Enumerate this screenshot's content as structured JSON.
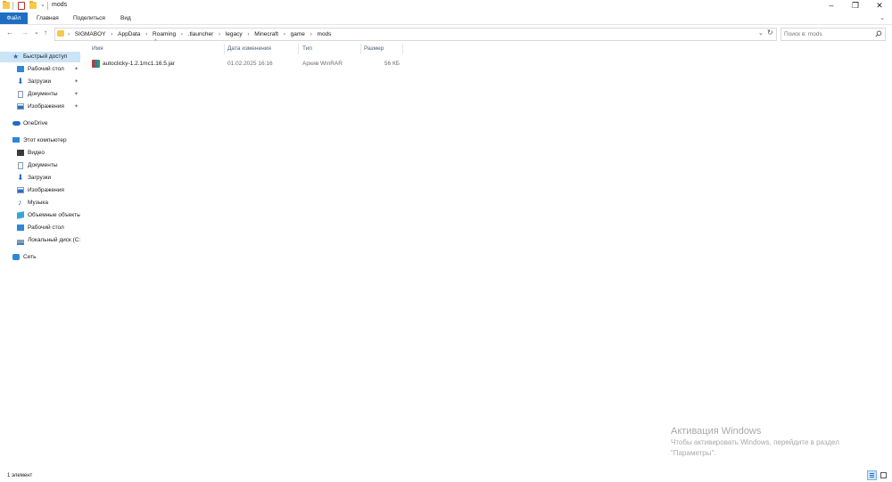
{
  "window": {
    "title": "mods",
    "controls": {
      "minimize": "–",
      "maximize": "❐",
      "close": "✕"
    }
  },
  "ribbon": {
    "tabs": [
      "Файл",
      "Главная",
      "Поделиться",
      "Вид"
    ],
    "chevron": "⌄"
  },
  "nav": {
    "back": "←",
    "forward": "→",
    "recent": "⌄",
    "up": "↑",
    "refresh": "↻",
    "addr_dropdown": "⌄"
  },
  "address": {
    "crumbs": [
      "SIGMABOY",
      "AppData",
      "Roaming",
      ".tlauncher",
      "legacy",
      "Minecraft",
      "game",
      "mods"
    ],
    "separator": "›"
  },
  "search": {
    "placeholder": "Поиск в: mods",
    "icon": "search-icon"
  },
  "sidebar": {
    "quick_access": {
      "label": "Быстрый доступ",
      "items": [
        {
          "label": "Рабочий стол",
          "icon": "desktop-icon",
          "pinned": true
        },
        {
          "label": "Загрузки",
          "icon": "download-icon",
          "pinned": true
        },
        {
          "label": "Документы",
          "icon": "document-icon",
          "pinned": true
        },
        {
          "label": "Изображения",
          "icon": "image-icon",
          "pinned": true
        }
      ]
    },
    "onedrive": {
      "label": "OneDrive"
    },
    "this_pc": {
      "label": "Этот компьютер",
      "items": [
        {
          "label": "Видео",
          "icon": "video-icon"
        },
        {
          "label": "Документы",
          "icon": "document-icon"
        },
        {
          "label": "Загрузки",
          "icon": "download-icon"
        },
        {
          "label": "Изображения",
          "icon": "image-icon"
        },
        {
          "label": "Музыка",
          "icon": "music-icon"
        },
        {
          "label": "Объемные объекты",
          "icon": "3d-objects-icon"
        },
        {
          "label": "Рабочий стол",
          "icon": "desktop-icon"
        },
        {
          "label": "Локальный диск (C:)",
          "icon": "drive-icon"
        }
      ]
    },
    "network": {
      "label": "Сеть"
    },
    "pin_glyph": "📌"
  },
  "columns": {
    "name": "Имя",
    "date": "Дата изменения",
    "type": "Тип",
    "size": "Размер",
    "sort_indicator": "^"
  },
  "files": [
    {
      "name": "autoclicky-1.2.1mc1.16.5.jar",
      "date": "01.02.2025 16:16",
      "type": "Архив WinRAR",
      "size": "56 КБ",
      "icon": "winrar-archive-icon"
    }
  ],
  "activation": {
    "title": "Активация Windows",
    "line1": "Чтобы активировать Windows, перейдите в раздел",
    "line2": "\"Параметры\"."
  },
  "status": {
    "count": "1 элемент"
  },
  "colors": {
    "accent": "#1e6fc2",
    "selection": "#cce4f7",
    "header_text": "#4c607a",
    "muted": "#6d6d6d"
  }
}
